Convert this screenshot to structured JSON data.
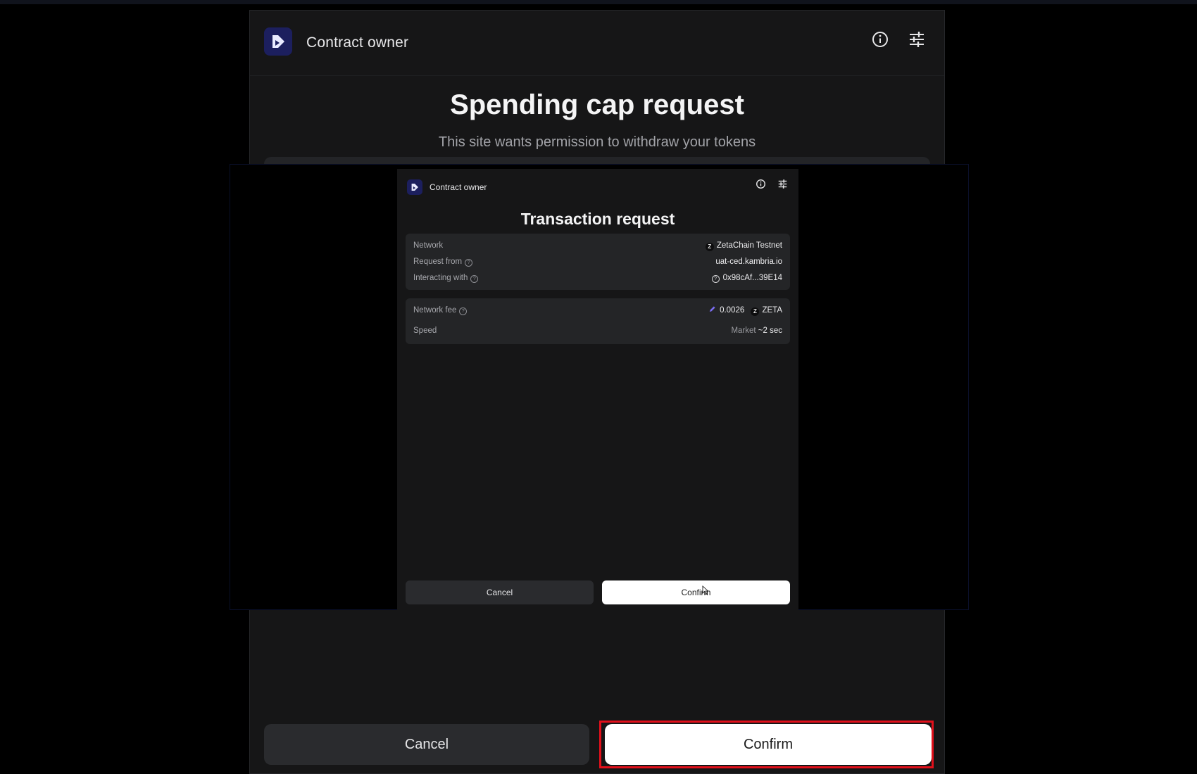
{
  "outer": {
    "title": "Contract owner",
    "heading": "Spending cap request",
    "subtitle": "This site wants permission to withdraw your tokens",
    "cancel_label": "Cancel",
    "confirm_label": "Confirm",
    "icons": [
      "app-logo-icon",
      "info-icon",
      "settings-sliders-icon"
    ]
  },
  "inner": {
    "title": "Contract owner",
    "heading": "Transaction request",
    "details": {
      "network_label": "Network",
      "network_value": "ZetaChain Testnet",
      "request_from_label": "Request from",
      "request_from_value": "uat-ced.kambria.io",
      "interacting_label": "Interacting with",
      "interacting_value": "0x98cAf...39E14"
    },
    "fees": {
      "network_fee_label": "Network fee",
      "network_fee_amount": "0.0026",
      "network_fee_token": "ZETA",
      "speed_label": "Speed",
      "speed_mode": "Market",
      "speed_time": "~2 sec"
    },
    "cancel_label": "Cancel",
    "confirm_label": "Confirm",
    "token_glyph": "Z"
  },
  "colors": {
    "highlight": "#e2101b",
    "brand_logo_bg": "#1c1f5e",
    "panel_bg": "#161617",
    "card_bg": "#242527"
  }
}
